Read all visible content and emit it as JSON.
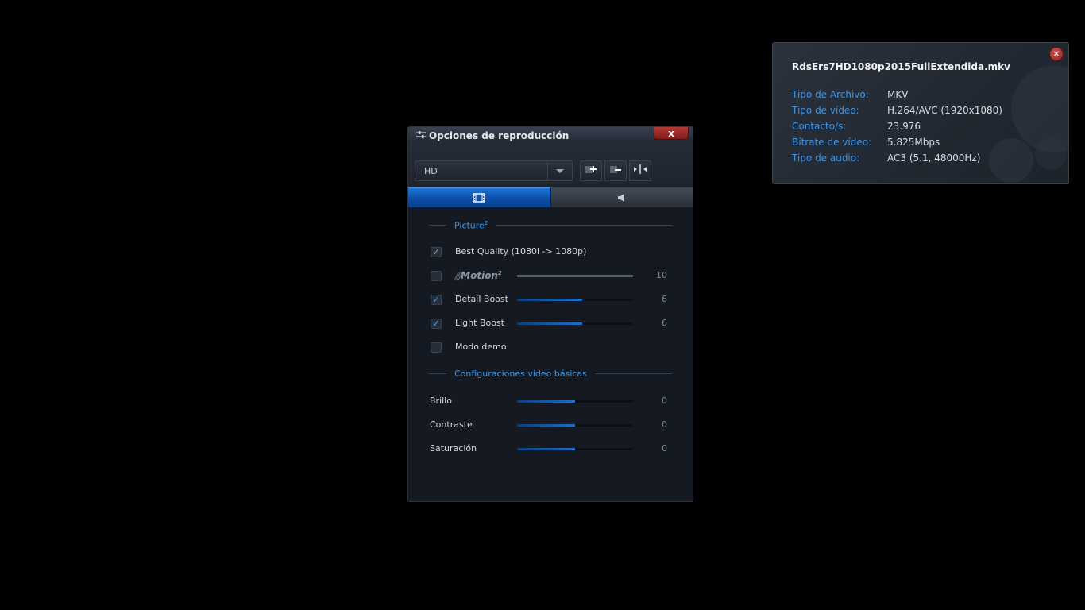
{
  "playback_panel": {
    "title": "Opciones de reproducción",
    "close_label": "x",
    "preset_value": "HD",
    "tabs": [
      {
        "icon": "film-icon",
        "active": true
      },
      {
        "icon": "speaker-icon",
        "active": false
      }
    ],
    "picture_section": {
      "label": "Picture",
      "sup": "2"
    },
    "best_quality": {
      "label": "Best Quality (1080i -> 1080p)",
      "checked": true
    },
    "motion": {
      "label": "Motion",
      "sup": "2",
      "value": "10",
      "checked": false
    },
    "detail_boost": {
      "label": "Detail Boost",
      "value": "6",
      "checked": true,
      "level": 0.56
    },
    "light_boost": {
      "label": "Light Boost",
      "value": "6",
      "checked": true,
      "level": 0.56
    },
    "demo_mode": {
      "label": "Modo demo",
      "checked": false
    },
    "basic_section": {
      "label": "Configuraciones video básicas"
    },
    "brightness": {
      "label": "Brillo",
      "value": "0",
      "level": 0.5
    },
    "contrast": {
      "label": "Contraste",
      "value": "0",
      "level": 0.5
    },
    "saturation": {
      "label": "Saturación",
      "value": "0",
      "level": 0.5
    }
  },
  "info_panel": {
    "filename": "RdsErs7HD1080p2015FullExtendida.mkv",
    "rows": [
      {
        "key": "Tipo de Archivo:",
        "value": "MKV"
      },
      {
        "key": "Tipo de vídeo:",
        "value": "H.264/AVC (1920x1080)"
      },
      {
        "key": "Contacto/s:",
        "value": "23.976"
      },
      {
        "key": "Bitrate de vídeo:",
        "value": "5.825Mbps"
      },
      {
        "key": "Tipo de audio:",
        "value": "AC3 (5.1, 48000Hz)"
      }
    ]
  },
  "colors": {
    "accent": "#3c97e6",
    "active_tab": "#1f76d8",
    "close": "#b33a36"
  }
}
